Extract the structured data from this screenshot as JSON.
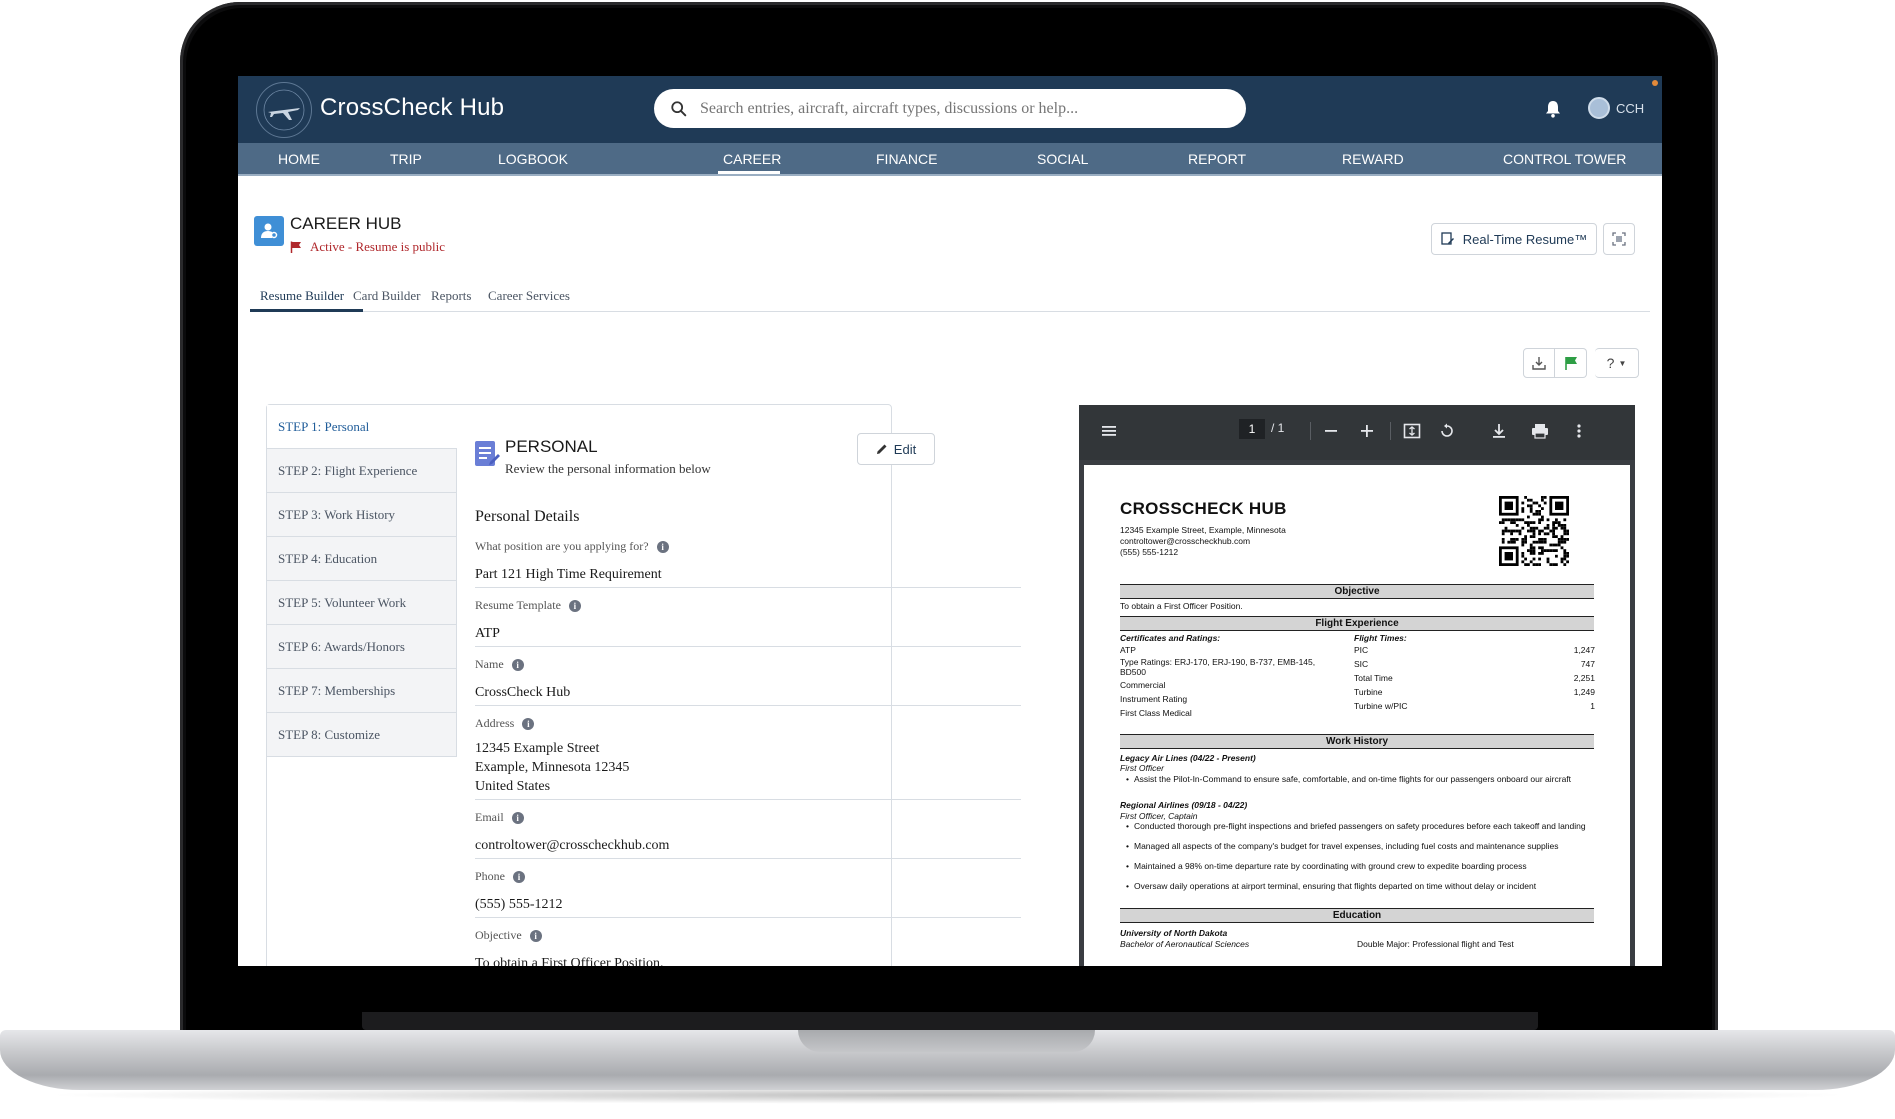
{
  "app": {
    "brand": "CrossCheck Hub",
    "search_placeholder": "Search entries, aircraft, aircraft types, discussions or help...",
    "user_initials": "CCH"
  },
  "nav": [
    "HOME",
    "TRIP",
    "LOGBOOK",
    "CAREER",
    "FINANCE",
    "SOCIAL",
    "REPORT",
    "REWARD",
    "CONTROL TOWER"
  ],
  "nav_active": "CAREER",
  "page": {
    "title": "CAREER HUB",
    "status": "Active - Resume is public",
    "realtime_button": "Real-Time Resume™"
  },
  "tabs": [
    "Resume Builder",
    "Card Builder",
    "Reports",
    "Career Services"
  ],
  "tool_help": "?",
  "steps": [
    "STEP 1: Personal",
    "STEP 2: Flight Experience",
    "STEP 3: Work History",
    "STEP 4: Education",
    "STEP 5: Volunteer Work",
    "STEP 6: Awards/Honors",
    "STEP 7: Memberships",
    "STEP 8: Customize"
  ],
  "personal": {
    "title": "PERSONAL",
    "subtitle": "Review the personal information below",
    "edit_label": "Edit",
    "details_title": "Personal Details",
    "fields": [
      {
        "label": "What position are you applying for?",
        "value": "Part 121 High Time Requirement"
      },
      {
        "label": "Resume Template",
        "value": "ATP"
      },
      {
        "label": "Name",
        "value": "CrossCheck Hub"
      },
      {
        "label": "Address",
        "value": "12345 Example Street\nExample, Minnesota 12345\nUnited States"
      },
      {
        "label": "Email",
        "value": "controltower@crosscheckhub.com"
      },
      {
        "label": "Phone",
        "value": "(555) 555-1212"
      },
      {
        "label": "Objective",
        "value": "To obtain a First Officer Position."
      }
    ]
  },
  "pdf_viewer": {
    "page_current": "1",
    "page_total": "/ 1"
  },
  "resume": {
    "name": "CROSSCHECK HUB",
    "address_line1": "12345 Example Street, Example, Minnesota",
    "email": "controltower@crosscheckhub.com",
    "phone": "(555) 555-1212",
    "sections": {
      "objective": "Objective",
      "flight_experience": "Flight Experience",
      "work_history": "Work History",
      "education": "Education"
    },
    "objective_text": "To obtain a First Officer Position.",
    "certs_heading": "Certificates and Ratings:",
    "certs": [
      "ATP",
      "Type Ratings: ERJ-170, ERJ-190, B-737, EMB-145,",
      "BD500",
      "Commercial",
      "Instrument Rating",
      "First Class Medical"
    ],
    "times_heading": "Flight Times:",
    "times": [
      {
        "label": "PIC",
        "value": "1,247"
      },
      {
        "label": "SIC",
        "value": "747"
      },
      {
        "label": "Total Time",
        "value": "2,251"
      },
      {
        "label": "Turbine",
        "value": "1,249"
      },
      {
        "label": "Turbine w/PIC",
        "value": "1"
      }
    ],
    "jobs": [
      {
        "company": "Legacy Air Lines (04/22 - Present)",
        "role": "First Officer",
        "bullets": [
          "Assist the Pilot-In-Command to ensure safe, comfortable, and on-time flights for our passengers onboard our aircraft"
        ]
      },
      {
        "company": "Regional Airlines (09/18 - 04/22)",
        "role": "First Officer, Captain",
        "bullets": [
          "Conducted thorough pre-flight inspections and briefed passengers on safety procedures before each takeoff and landing",
          "Managed all aspects of the company's budget for travel expenses, including fuel costs and maintenance supplies",
          "Maintained a 98% on-time departure rate by coordinating with ground crew to expedite boarding process",
          "Oversaw daily operations at airport terminal, ensuring that flights departed on time without delay or incident"
        ]
      }
    ],
    "school": "University of North Dakota",
    "degree": "Bachelor of Aeronautical Sciences",
    "major": "Double Major: Professional flight and Test"
  }
}
